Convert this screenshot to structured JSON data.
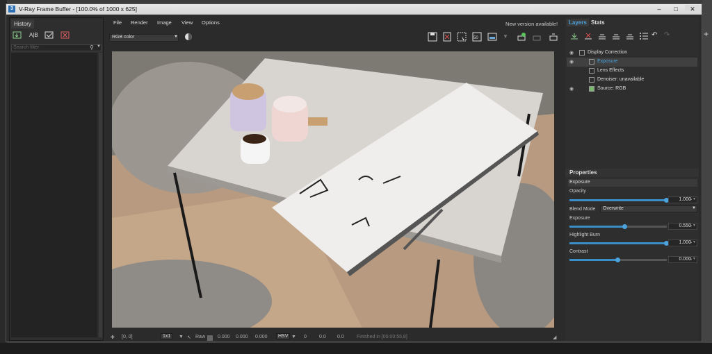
{
  "window": {
    "title": "V-Ray Frame Buffer - [100.0% of 1000 x 625]",
    "app_icon": "3"
  },
  "history": {
    "tab": "History",
    "search_placeholder": "Search filter"
  },
  "menu": {
    "items": [
      "File",
      "Render",
      "Image",
      "View",
      "Options"
    ],
    "notice": "New version available!"
  },
  "toolbar": {
    "channel": "RGB color"
  },
  "status": {
    "coords": "[0, 0]",
    "zoom": "1x1",
    "raw_label": "Raw",
    "raw_values": [
      "0.000",
      "0.000",
      "0.000"
    ],
    "color_mode": "HSV",
    "hsv_values": [
      "0",
      "0.0",
      "0.0"
    ],
    "render_time": "Finished in [00:00:55,8]"
  },
  "right": {
    "tabs": [
      "Layers",
      "Stats"
    ],
    "layers": [
      {
        "label": "Display Correction",
        "visible": true
      },
      {
        "label": "Exposure",
        "visible": true,
        "selected": true
      },
      {
        "label": "Lens Effects",
        "visible": false
      },
      {
        "label": "Denoiser: unavailable",
        "visible": false
      },
      {
        "label": "Source: RGB",
        "visible": true
      }
    ],
    "properties": {
      "header": "Properties",
      "layer_name": "Exposure",
      "opacity_label": "Opacity",
      "opacity": "1.000",
      "opacity_frac": 1.0,
      "blend_label": "Blend Mode",
      "blend": "Overwrite",
      "exposure_label": "Exposure",
      "exposure": "0.550",
      "exposure_frac": 0.57,
      "highlight_label": "Highlight Burn",
      "highlight": "1.000",
      "highlight_frac": 1.0,
      "contrast_label": "Contrast",
      "contrast": "0.000",
      "contrast_frac": 0.5
    }
  },
  "accent_color": "#3a8fc9"
}
